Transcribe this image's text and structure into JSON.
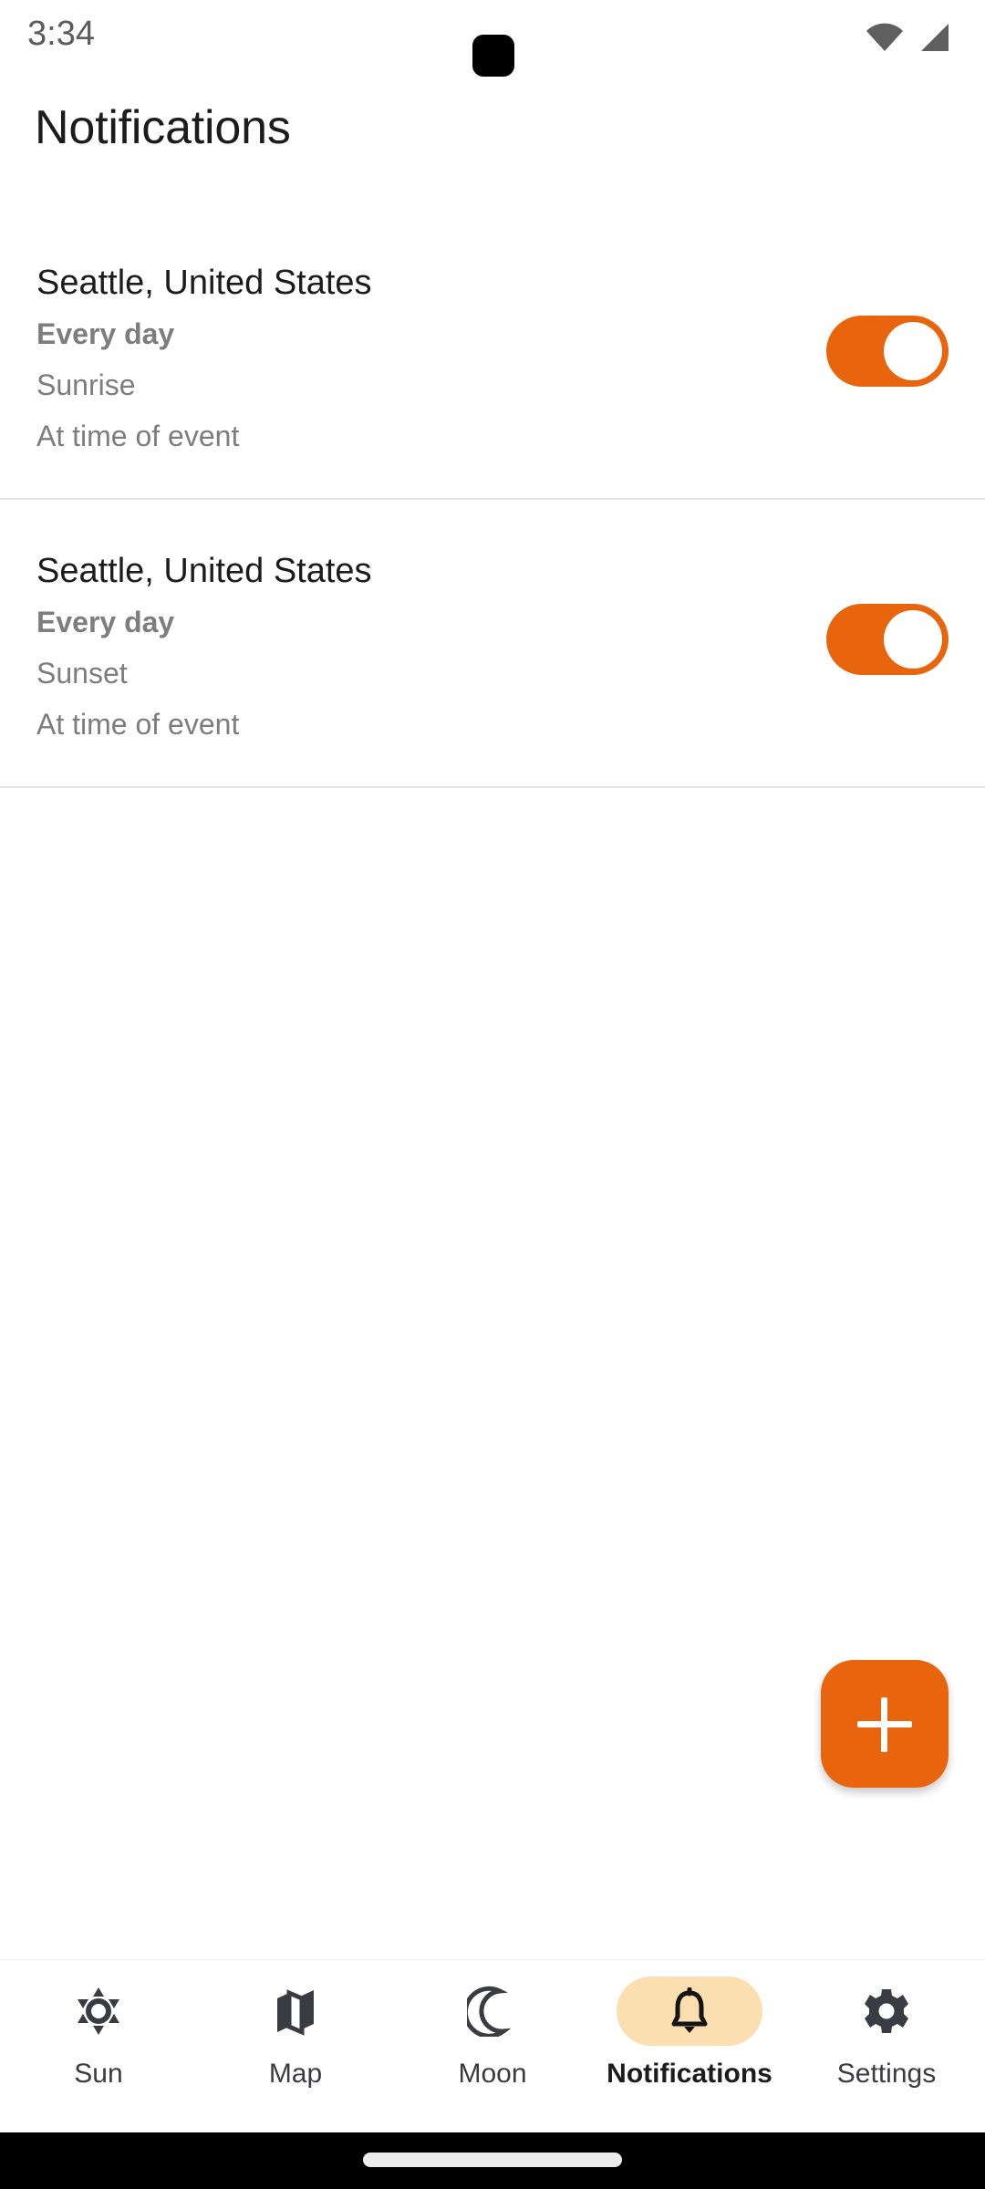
{
  "status_bar": {
    "time": "3:34",
    "icons": [
      "wifi-icon",
      "cellular-signal-icon"
    ],
    "punch_hole": "camera-punch-hole"
  },
  "header": {
    "title": "Notifications"
  },
  "colors": {
    "accent_orange": "#e8650d",
    "active_pill_peach": "#fbdfb0",
    "primary_text": "#1c1c1c",
    "secondary_text": "#7d7d7d",
    "divider": "#e3e3e3",
    "nav_icon": "#3b3b43"
  },
  "notifications": [
    {
      "location": "Seattle, United States",
      "repeat": "Every day",
      "event": "Sunrise",
      "timing": "At time of event",
      "enabled": true
    },
    {
      "location": "Seattle, United States",
      "repeat": "Every day",
      "event": "Sunset",
      "timing": "At time of event",
      "enabled": true
    }
  ],
  "fab": {
    "label": "+",
    "icon": "plus-icon"
  },
  "bottom_nav": {
    "active_index": 3,
    "items": [
      {
        "label": "Sun",
        "icon": "sun-icon"
      },
      {
        "label": "Map",
        "icon": "map-icon"
      },
      {
        "label": "Moon",
        "icon": "moon-icon"
      },
      {
        "label": "Notifications",
        "icon": "bell-icon"
      },
      {
        "label": "Settings",
        "icon": "gear-icon"
      }
    ]
  },
  "gesture_bar": {
    "handle": "home-indicator"
  }
}
